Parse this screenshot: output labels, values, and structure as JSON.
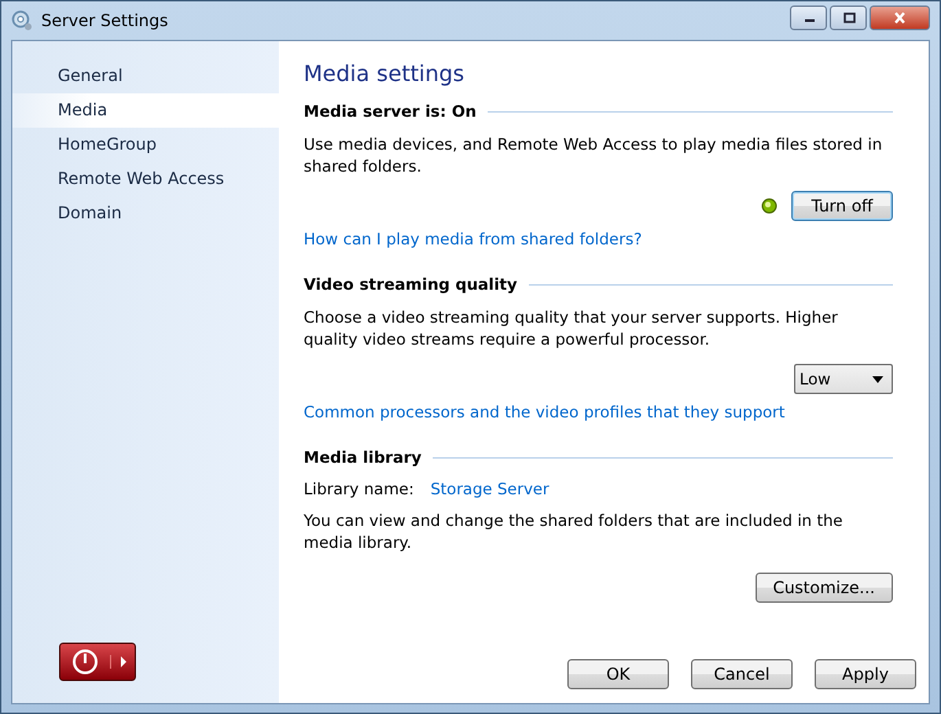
{
  "window": {
    "title": "Server Settings"
  },
  "sidebar": {
    "items": [
      {
        "label": "General",
        "selected": false
      },
      {
        "label": "Media",
        "selected": true
      },
      {
        "label": "HomeGroup",
        "selected": false
      },
      {
        "label": "Remote Web Access",
        "selected": false
      },
      {
        "label": "Domain",
        "selected": false
      }
    ]
  },
  "content": {
    "title": "Media settings",
    "server": {
      "heading": "Media server is: On",
      "description": "Use media devices, and Remote Web Access to play media files stored in shared folders.",
      "running": true,
      "button": "Turn off",
      "link": "How can I play media from shared folders?"
    },
    "streaming": {
      "heading": "Video streaming quality",
      "description": "Choose a video streaming quality that your server supports. Higher quality video streams require a powerful processor.",
      "quality": "Low",
      "link": "Common processors and the video profiles that they support"
    },
    "library": {
      "heading": "Media library",
      "name_label": "Library name:",
      "name": "Storage Server",
      "description": "You can view and change the shared folders that are included in the media library.",
      "button": "Customize..."
    }
  },
  "buttons": [
    "OK",
    "Cancel",
    "Apply"
  ]
}
